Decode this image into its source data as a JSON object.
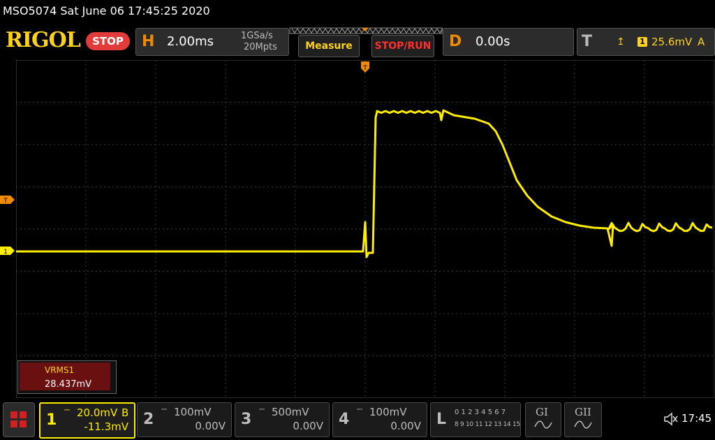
{
  "window_title": "MSO5074  Sat June 06 17:45:25 2020",
  "logo": "RIGOL",
  "run_state": "STOP",
  "horizontal": {
    "letter": "H",
    "timebase": "2.00ms",
    "sample_rate": "1GSa/s",
    "memory_depth": "20Mpts"
  },
  "buttons": {
    "measure": "Measure",
    "stop_run": "STOP/RUN"
  },
  "delay": {
    "letter": "D",
    "value": "0.00s"
  },
  "trigger": {
    "letter": "T",
    "source_channel": "1",
    "level": "25.6mV",
    "mode": "A"
  },
  "markers": {
    "trigger_top": "T",
    "trigger_level": "T",
    "ch1_ground": "1"
  },
  "measurement": {
    "label": "VRMS1",
    "value": "28.437mV"
  },
  "channels": [
    {
      "num": "1",
      "scale": "20.0mV",
      "bw": "B",
      "offset": "-11.3mV",
      "color": "#ffee00"
    },
    {
      "num": "2",
      "scale": "100mV",
      "bw": "",
      "offset": "0.00V",
      "color": "#bdbdbd"
    },
    {
      "num": "3",
      "scale": "500mV",
      "bw": "",
      "offset": "0.00V",
      "color": "#bdbdbd"
    },
    {
      "num": "4",
      "scale": "100mV",
      "bw": "",
      "offset": "0.00V",
      "color": "#bdbdbd"
    }
  ],
  "logic": {
    "letter": "L",
    "row1": "0 1 2 3  4 5 6 7",
    "row2": "8 9 10 11  12 13 14 15"
  },
  "decoders": {
    "g1": "GI",
    "g2": "GII"
  },
  "clock": "17:45",
  "colors": {
    "trace": "#ffee00",
    "accent_orange": "#f08a00",
    "stop_red": "#e23b3b",
    "measure_bg": "#6a1010"
  }
}
